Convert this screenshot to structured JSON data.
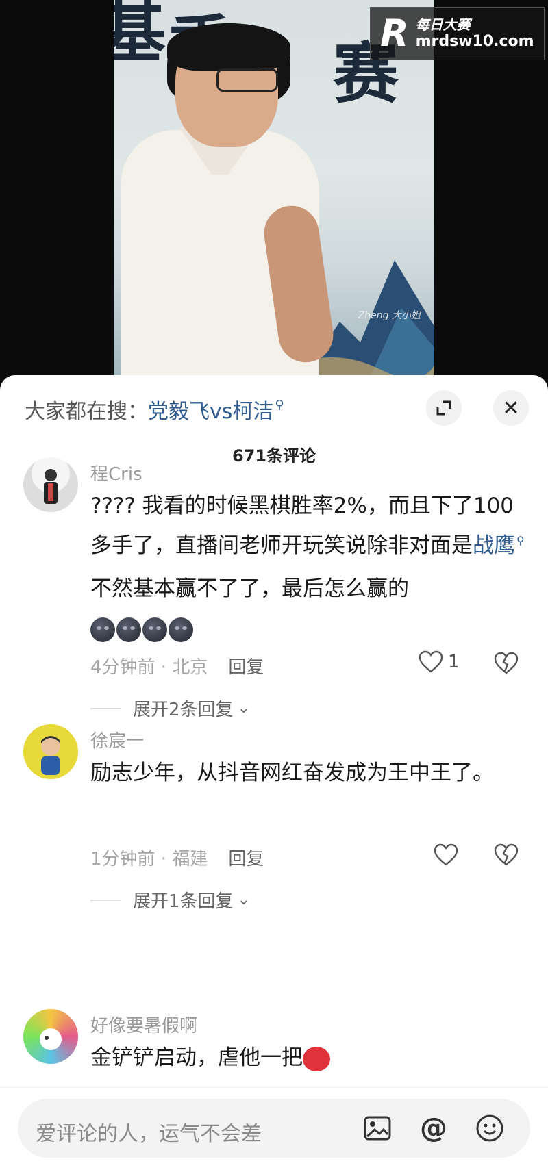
{
  "video": {
    "banner_chars": [
      "基",
      "季",
      "赛"
    ],
    "watermark_small": "Zheng 大小姐",
    "logo": {
      "letter": "R",
      "cn": "每日大赛",
      "en": "mrdsw10.com"
    }
  },
  "sheet": {
    "search_prefix": "大家都在搜：",
    "search_link": "党毅飞vs柯洁",
    "comment_count": "671条评论",
    "comments": [
      {
        "user": "程Cris",
        "text_before_link": "????  我看的时候黑棋胜率2%，而且下了100多手了，直播间老师开玩笑说除非对面是",
        "link": "战鹰",
        "text_after_link": "不然基本赢不了了，最后怎么赢的",
        "time_location": "4分钟前 · 北京",
        "reply": "回复",
        "likes": "1",
        "expand": "展开2条回复"
      },
      {
        "user": "徐宸一",
        "text": "励志少年，从抖音网红奋发成为王中王了。",
        "time_location": "1分钟前 · 福建",
        "reply": "回复",
        "expand": "展开1条回复"
      },
      {
        "user": "好像要暑假啊",
        "text": "金铲铲启动，虐他一把"
      }
    ]
  },
  "input": {
    "placeholder": "爱评论的人，运气不会差"
  },
  "colors": {
    "link": "#2f5b8f",
    "muted": "#a5a5a5"
  }
}
